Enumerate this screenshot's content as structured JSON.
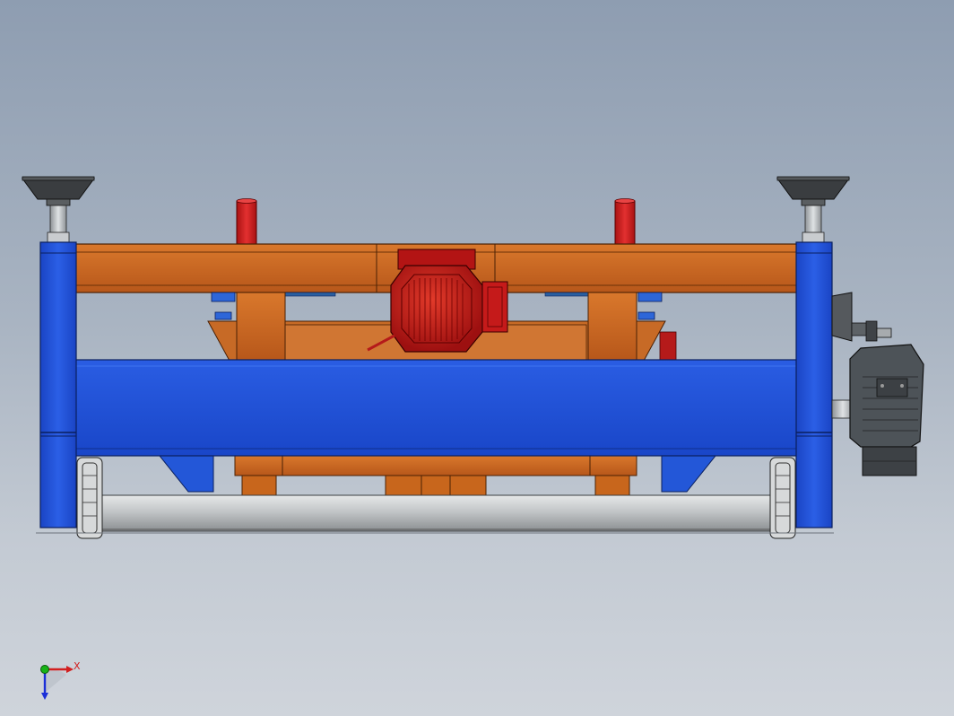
{
  "viewport": {
    "background_top": "#8e9db1",
    "background_bottom": "#cfd4db"
  },
  "colors": {
    "frame_blue": "#1f4fd6",
    "beam_orange": "#c8661c",
    "motor_red": "#c01818",
    "gearbox_grey": "#4d5358",
    "roller_grey": "#b9bcbe",
    "foot_dark": "#3a3d40"
  },
  "axis_triad": {
    "x_label": "X",
    "x_color": "#d21f1f",
    "y_color": "#17b317",
    "z_color": "#1b2fd8"
  }
}
